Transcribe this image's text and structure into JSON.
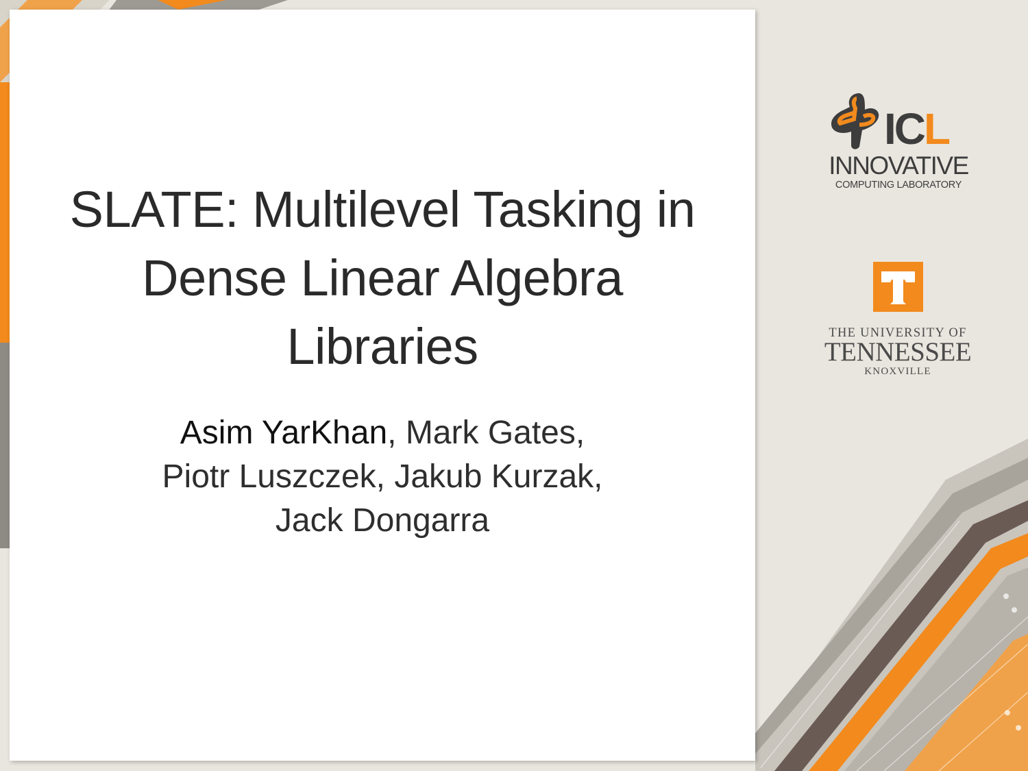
{
  "slide": {
    "title_lines": [
      "SLATE: Multilevel Tasking in",
      "Dense Linear Algebra",
      "Libraries"
    ],
    "authors": {
      "presenter": "Asim YarKhan",
      "line1_rest": ", Mark Gates,",
      "line2": "Piotr Luszczek, Jakub Kurzak,",
      "line3": "Jack Dongarra"
    }
  },
  "logos": {
    "icl": {
      "letters_dark": "IC",
      "letters_orange": "L",
      "name": "INNOVATIVE",
      "subname": "COMPUTING LABORATORY"
    },
    "ut": {
      "icon": "ut-t-icon",
      "line1": "THE UNIVERSITY OF",
      "line2": "TENNESSEE",
      "line3": "KNOXVILLE"
    }
  },
  "colors": {
    "accent_orange": "#f28a1d",
    "logo_gray": "#3d3d3d",
    "text_dark": "#2a2a2a"
  }
}
